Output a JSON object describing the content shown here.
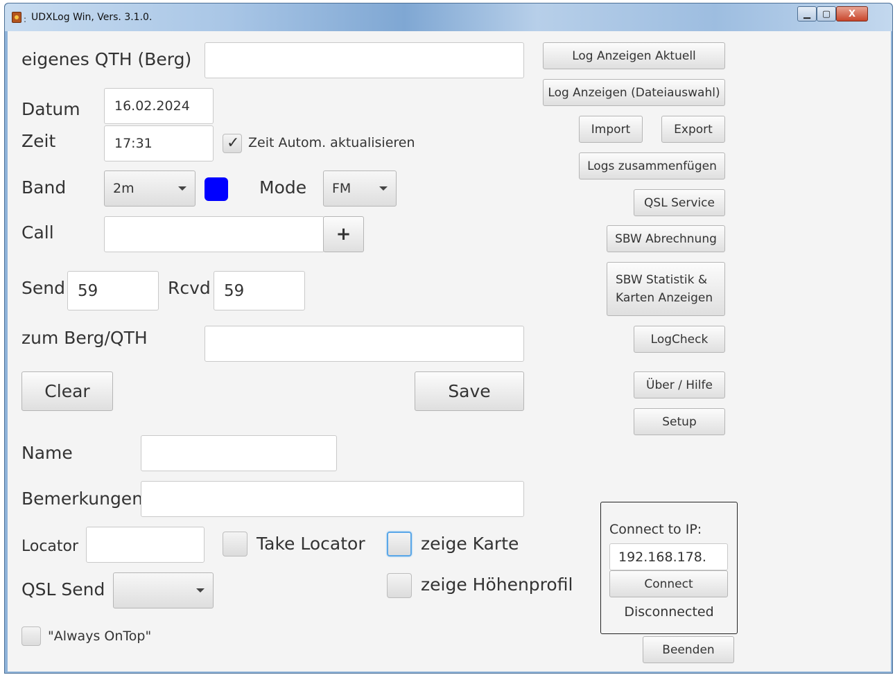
{
  "window": {
    "title": "UDXLog Win, Vers. 3.1.0.",
    "controls": {
      "minimize": "▁",
      "maximize": "▢",
      "close": "X"
    }
  },
  "form": {
    "own_qth_label": "eigenes QTH (Berg)",
    "own_qth_value": "",
    "date_label": "Datum",
    "date_value": "16.02.2024",
    "time_label": "Zeit",
    "time_value": "17:31",
    "auto_time_label": "Zeit Autom. aktualisieren",
    "auto_time_checked": "✓",
    "band_label": "Band",
    "band_value": "2m",
    "band_color": "#0000ff",
    "mode_label": "Mode",
    "mode_value": "FM",
    "call_label": "Call",
    "call_value": "",
    "call_add_button": "+",
    "send_label": "Send",
    "send_value": "59",
    "rcvd_label": "Rcvd",
    "rcvd_value": "59",
    "to_qth_label": "zum Berg/QTH",
    "to_qth_value": "",
    "clear_button": "Clear",
    "save_button": "Save",
    "name_label": "Name",
    "name_value": "",
    "remarks_label": "Bemerkungen",
    "remarks_value": "",
    "locator_label": "Locator",
    "locator_value": "",
    "take_locator_label": "Take Locator",
    "show_map_label": "zeige Karte",
    "show_profile_label": "zeige Höhenprofil",
    "qsl_send_label": "QSL Send",
    "qsl_send_value": "",
    "always_on_top_label": "\"Always OnTop\""
  },
  "sidebar": {
    "log_current": "Log Anzeigen Aktuell",
    "log_file": "Log Anzeigen (Dateiauswahl)",
    "import": "Import",
    "export": "Export",
    "merge_logs": "Logs zusammenfügen",
    "qsl_service": "QSL Service",
    "sbw_billing": "SBW Abrechnung",
    "sbw_stats_line1": "SBW Statistik &",
    "sbw_stats_line2": "Karten Anzeigen",
    "logcheck": "LogCheck",
    "about_help": "Über / Hilfe",
    "setup": "Setup"
  },
  "connection": {
    "label": "Connect to IP:",
    "ip_value": "192.168.178.",
    "connect_button": "Connect",
    "status": "Disconnected"
  },
  "exit_button": "Beenden"
}
